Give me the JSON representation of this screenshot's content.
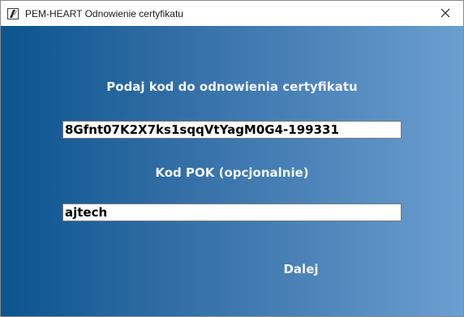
{
  "window": {
    "title": "PEM-HEART Odnowienie certyfikatu",
    "icon": "pem-heart-app-icon",
    "close_icon": "close-icon"
  },
  "form": {
    "renewal_code_label": "Podaj kod do odnowienia certyfikatu",
    "renewal_code_value": "8Gfnt07K2X7ks1sqqVtYagM0G4-199331",
    "pok_code_label": "Kod POK (opcjonalnie)",
    "pok_code_value": "ajtech",
    "next_button_label": "Dalej"
  },
  "colors": {
    "gradient_start": "#0b548f",
    "gradient_end": "#6c9fd0",
    "label_text": "#f2f4f8"
  }
}
